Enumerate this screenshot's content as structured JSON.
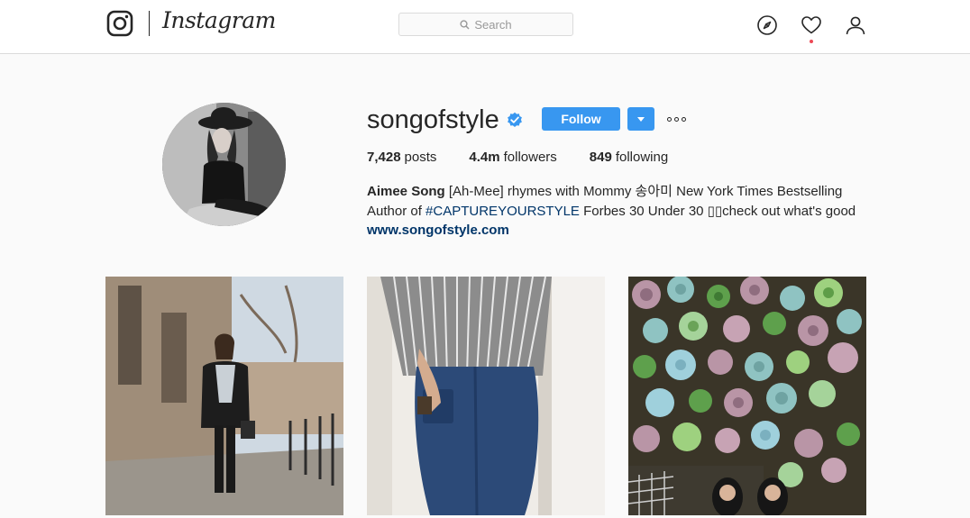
{
  "nav": {
    "wordmark": "Instagram",
    "search_placeholder": "Search",
    "icons": [
      "instagram-glyph-icon",
      "search-icon",
      "compass-icon",
      "heart-icon",
      "user-icon"
    ],
    "activity_dot_color": "#ed4956"
  },
  "profile": {
    "username": "songofstyle",
    "verified": true,
    "follow_label": "Follow",
    "stats": {
      "posts_count": "7,428",
      "posts_label": "posts",
      "followers_count": "4.4m",
      "followers_label": "followers",
      "following_count": "849",
      "following_label": "following"
    },
    "bio": {
      "full_name": "Aimee Song",
      "line1_rest": " [Ah-Mee] rhymes with Mommy 송아미 New York Times Bestselling",
      "line2_prefix": "Author of ",
      "hashtag": "#CAPTUREYOURSTYLE",
      "line2_suffix": " Forbes 30 Under 30 ▯▯check out what's good",
      "website": "www.songofstyle.com"
    }
  },
  "colors": {
    "accent": "#3897f0",
    "link": "#003569",
    "text": "#262626",
    "background": "#fafafa",
    "border": "#dbdbdb"
  },
  "posts": [
    {
      "subject": "street-style-photo"
    },
    {
      "subject": "striped-shirt-jeans-photo"
    },
    {
      "subject": "succulents-photo"
    }
  ]
}
